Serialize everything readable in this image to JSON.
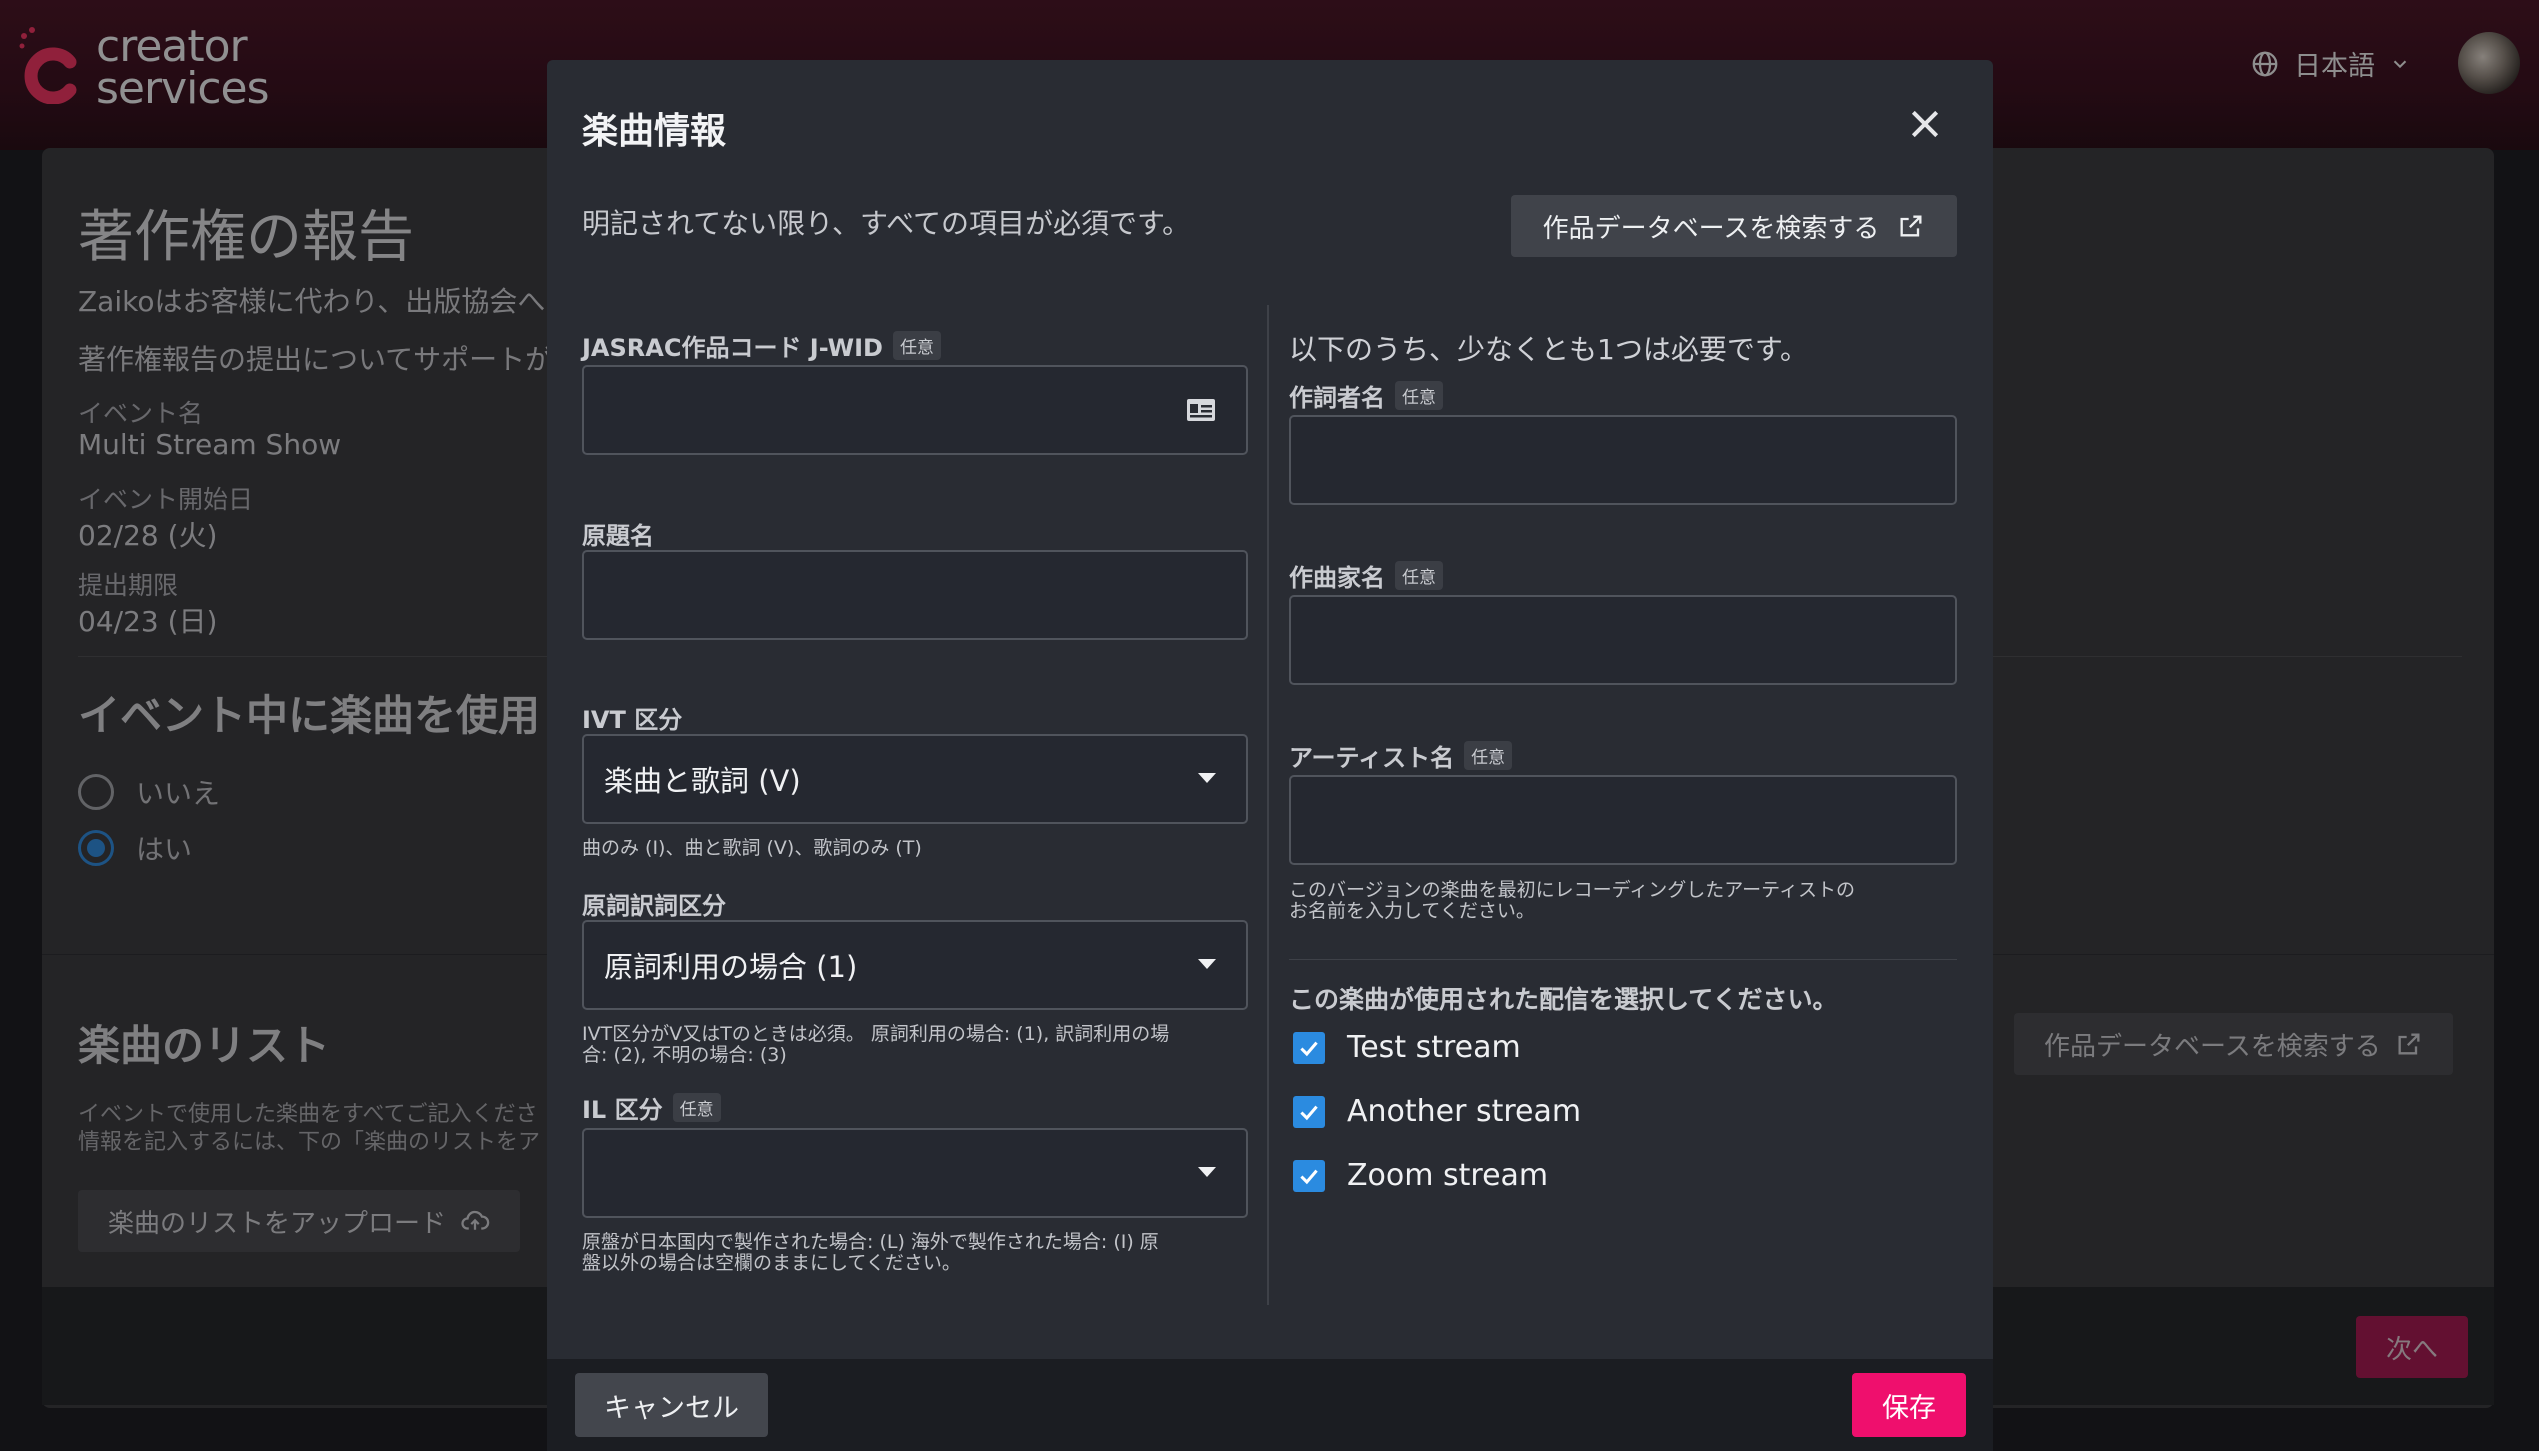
{
  "header": {
    "logo_text_line1": "creator",
    "logo_text_line2": "services",
    "language": "日本語"
  },
  "background": {
    "title": "著作権の報告",
    "intro_1": "Zaikoはお客様に代わり、出版協会へ",
    "intro_2": "著作権報告の提出についてサポートが",
    "event_name_label": "イベント名",
    "event_name": "Multi Stream Show",
    "event_start_label": "イベント開始日",
    "event_start": "02/28 (火)",
    "deadline_label": "提出期限",
    "deadline": "04/23 (日)",
    "question": "イベント中に楽曲を使用",
    "radio_no": "いいえ",
    "radio_yes": "はい",
    "song_list_title": "楽曲のリスト",
    "song_list_desc_1": "イベントで使用した楽曲をすべてご記入くださ",
    "song_list_desc_2": "情報を記入するには、下の「楽曲のリストをア",
    "upload_button": "楽曲のリストをアップロード",
    "search_db_button": "作品データベースを検索する",
    "next_button": "次へ"
  },
  "modal": {
    "title": "楽曲情報",
    "subtitle": "明記されてない限り、すべての項目が必須です。",
    "search_db_button": "作品データベースを検索する",
    "optional_badge": "任意",
    "jasrac_label": "JASRAC作品コード J-WID",
    "jasrac_value": "",
    "original_title_label": "原題名",
    "original_title_value": "",
    "ivt_label": "IVT 区分",
    "ivt_value": "楽曲と歌詞 (V)",
    "ivt_help": "曲のみ (I)、曲と歌詞 (V)、歌詞のみ (T)",
    "translation_label": "原詞訳詞区分",
    "translation_value": "原詞利用の場合 (1)",
    "translation_help_1": "IVT区分がV又はTのときは必須。 原詞利用の場合: (1), 訳詞利用の場",
    "translation_help_2": "合: (2), 不明の場合: (3)",
    "il_label": "IL 区分",
    "il_value": "",
    "il_help_1": "原盤が日本国内で製作された場合: (L) 海外で製作された場合: (I) 原",
    "il_help_2": "盤以外の場合は空欄のままにしてください。",
    "right_note": "以下のうち、少なくとも1つは必要です。",
    "lyricist_label": "作詞者名",
    "lyricist_value": "",
    "composer_label": "作曲家名",
    "composer_value": "",
    "artist_label": "アーティスト名",
    "artist_value": "",
    "artist_help_1": "このバージョンの楽曲を最初にレコーディングしたアーティストの",
    "artist_help_2": "お名前を入力してください。",
    "streams_title": "この楽曲が使用された配信を選択してください。",
    "streams": [
      {
        "label": "Test stream",
        "checked": true
      },
      {
        "label": "Another stream",
        "checked": true
      },
      {
        "label": "Zoom stream",
        "checked": true
      }
    ],
    "cancel_button": "キャンセル",
    "save_button": "保存"
  },
  "colors": {
    "accent": "#ef0f6d",
    "checkbox": "#2b8be0",
    "modal_bg": "#292c33"
  }
}
